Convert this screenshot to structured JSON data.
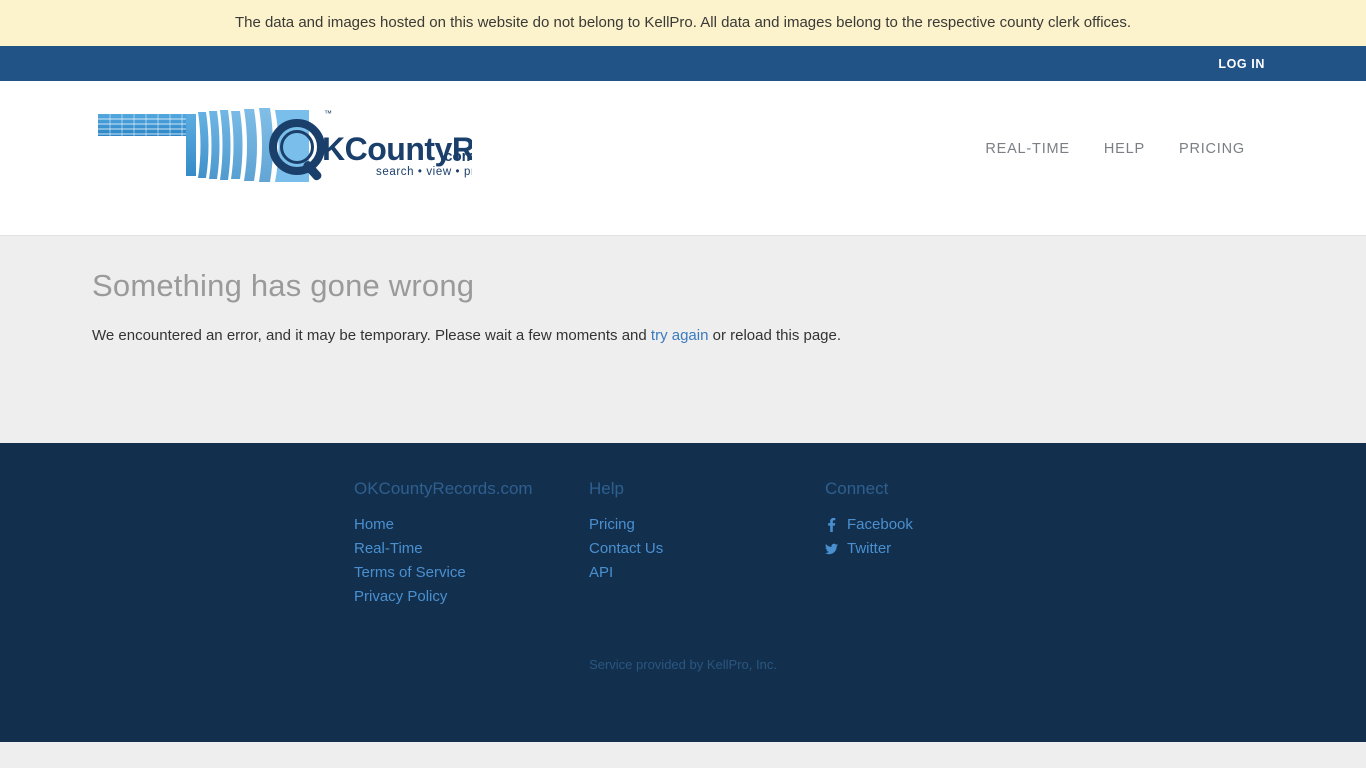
{
  "banner": {
    "text": "The data and images hosted on this website do not belong to KellPro. All data and images belong to the respective county clerk offices.",
    "background_color": "#fcf2cc"
  },
  "topbar": {
    "login_label": "LOG IN",
    "background_color": "#215387"
  },
  "header": {
    "logo": {
      "name": "okcountyrecords-logo",
      "wordmark": "OKCountyRecords",
      "domain_suffix": ".com",
      "tagline": "search • view • print",
      "trademark": "™"
    },
    "nav": [
      {
        "label": "REAL-TIME"
      },
      {
        "label": "HELP"
      },
      {
        "label": "PRICING"
      }
    ]
  },
  "main": {
    "title": "Something has gone wrong",
    "message_before_link": "We encountered an error, and it may be temporary. Please wait a few moments and ",
    "link_label": "try again",
    "message_after_link": " or reload this page.",
    "link_color": "#3a7bbf"
  },
  "footer": {
    "background_color": "#12304d",
    "columns": [
      {
        "heading": "OKCountyRecords.com",
        "links": [
          {
            "label": "Home"
          },
          {
            "label": "Real-Time"
          },
          {
            "label": "Terms of Service"
          },
          {
            "label": "Privacy Policy"
          }
        ]
      },
      {
        "heading": "Help",
        "links": [
          {
            "label": "Pricing"
          },
          {
            "label": "Contact Us"
          },
          {
            "label": "API"
          }
        ]
      },
      {
        "heading": "Connect",
        "links": [
          {
            "label": "Facebook",
            "icon": "facebook-icon",
            "glyph": "f"
          },
          {
            "label": "Twitter",
            "icon": "twitter-icon",
            "glyph": "🐦"
          }
        ]
      }
    ],
    "credit": "Service provided by KellPro, Inc."
  }
}
